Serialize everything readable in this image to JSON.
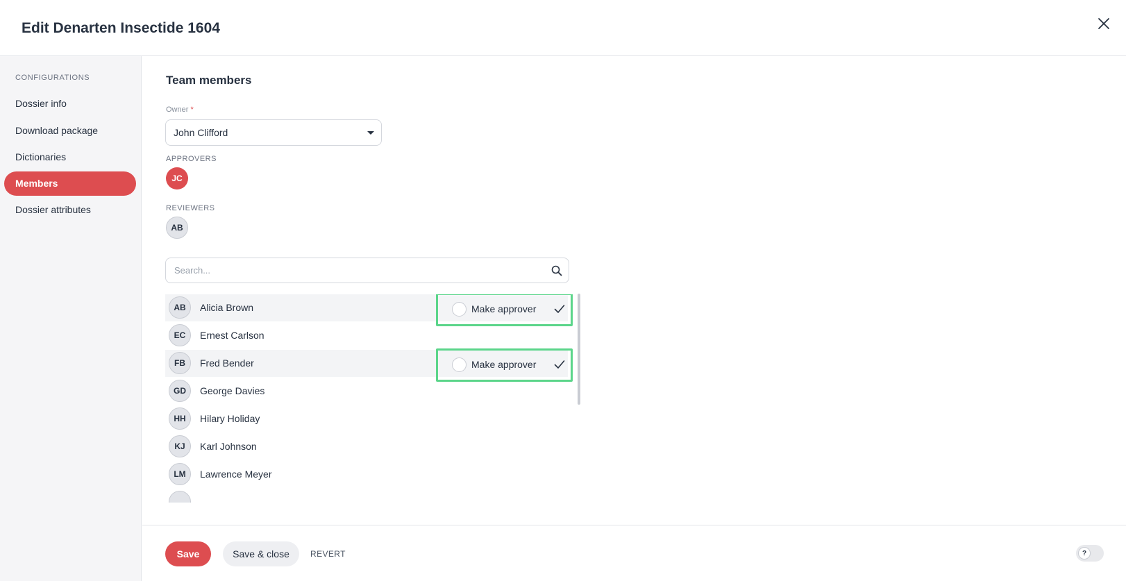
{
  "dialog": {
    "title": "Edit Denarten Insectide 1604"
  },
  "sidebar": {
    "heading": "CONFIGURATIONS",
    "items": [
      {
        "label": "Dossier info",
        "active": false
      },
      {
        "label": "Download package",
        "active": false
      },
      {
        "label": "Dictionaries",
        "active": false
      },
      {
        "label": "Members",
        "active": true
      },
      {
        "label": "Dossier attributes",
        "active": false
      }
    ]
  },
  "main": {
    "section_title": "Team members",
    "owner": {
      "label": "Owner",
      "required_mark": "*",
      "value": "John Clifford"
    },
    "approvers": {
      "label": "APPROVERS",
      "members": [
        {
          "initials": "JC"
        }
      ]
    },
    "reviewers": {
      "label": "REVIEWERS",
      "members": [
        {
          "initials": "AB"
        }
      ]
    },
    "search": {
      "placeholder": "Search...",
      "value": ""
    },
    "members": [
      {
        "initials": "AB",
        "name": "Alicia Brown",
        "highlighted": true,
        "action": "Make approver"
      },
      {
        "initials": "EC",
        "name": "Ernest Carlson",
        "highlighted": false
      },
      {
        "initials": "FB",
        "name": "Fred Bender",
        "highlighted": true,
        "action": "Make approver"
      },
      {
        "initials": "GD",
        "name": "George Davies",
        "highlighted": false
      },
      {
        "initials": "HH",
        "name": "Hilary Holiday",
        "highlighted": false
      },
      {
        "initials": "KJ",
        "name": "Karl Johnson",
        "highlighted": false
      },
      {
        "initials": "LM",
        "name": "Lawrence Meyer",
        "highlighted": false
      }
    ]
  },
  "footer": {
    "save_label": "Save",
    "save_close_label": "Save & close",
    "revert_label": "REVERT",
    "help_toggle_glyph": "?"
  },
  "colors": {
    "accent": "#dd4d50",
    "highlight_border": "#5bd58a",
    "sidebar_bg": "#f5f5f7",
    "row_highlight": "#f3f4f6"
  },
  "icons": {
    "close": "close-icon",
    "dropdown": "caret-down-icon",
    "search": "search-icon",
    "confirm": "check-icon",
    "help": "help-icon"
  }
}
